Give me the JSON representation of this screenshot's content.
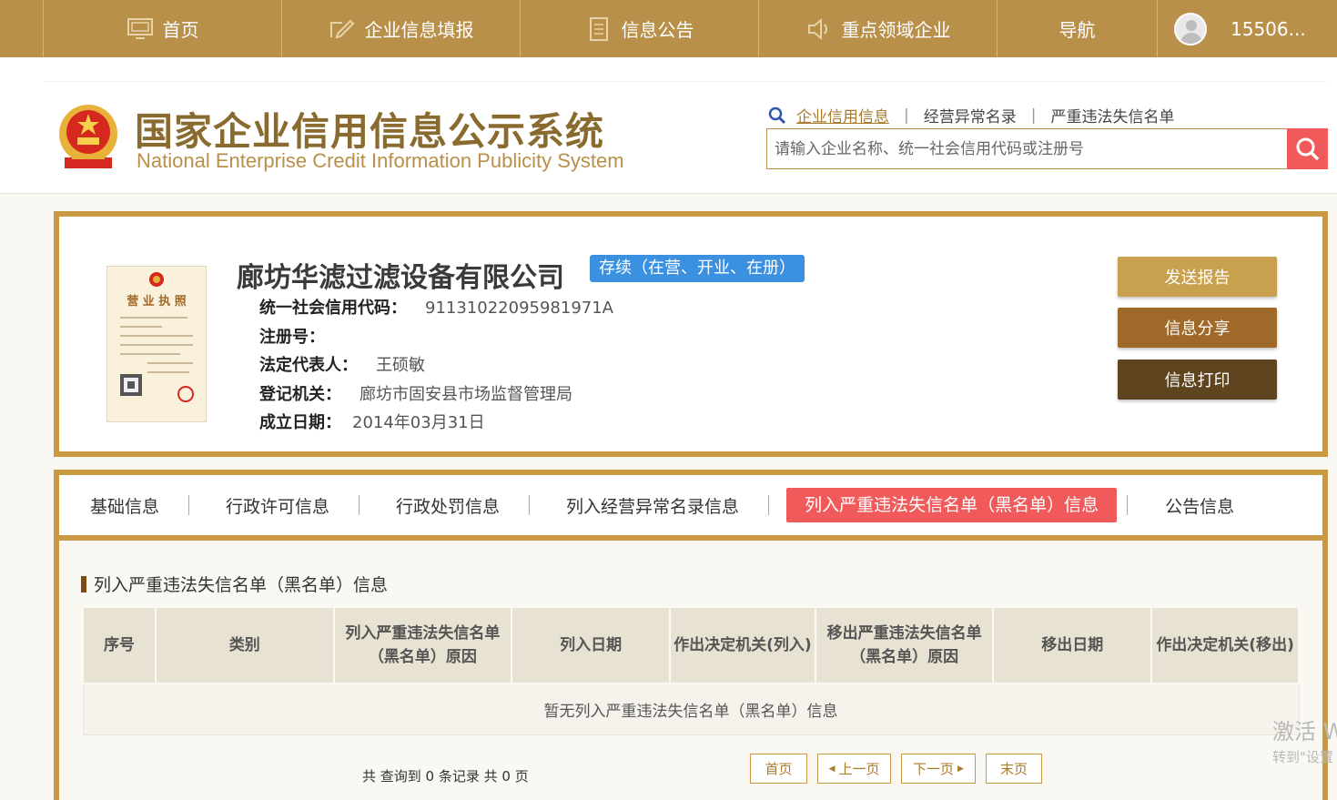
{
  "nav": {
    "home": "首页",
    "report": "企业信息填报",
    "notice": "信息公告",
    "key_sectors": "重点领域企业",
    "guide": "导航",
    "user": "15506..."
  },
  "site": {
    "title_cn": "国家企业信用信息公示系统",
    "title_en": "National Enterprise Credit Information Publicity System"
  },
  "search": {
    "tabs": [
      "企业信用信息",
      "经营异常名录",
      "严重违法失信名单"
    ],
    "placeholder": "请输入企业名称、统一社会信用代码或注册号"
  },
  "company": {
    "name": "廊坊华滤过滤设备有限公司",
    "status": "存续（在营、开业、在册）",
    "fields": [
      {
        "label": "统一社会信用代码：",
        "value": "91131022095981971A"
      },
      {
        "label": "注册号：",
        "value": ""
      },
      {
        "label": "法定代表人：",
        "value": "王硕敏"
      },
      {
        "label": "登记机关：",
        "value": "廊坊市固安县市场监督管理局"
      },
      {
        "label": "成立日期：",
        "value": "2014年03月31日"
      }
    ],
    "license_title": "营 业 执 照"
  },
  "actions": {
    "send": "发送报告",
    "share": "信息分享",
    "print": "信息打印"
  },
  "tabs": [
    {
      "label": "基础信息",
      "active": false
    },
    {
      "label": "行政许可信息",
      "active": false
    },
    {
      "label": "行政处罚信息",
      "active": false
    },
    {
      "label": "列入经营异常名录信息",
      "active": false
    },
    {
      "label": "列入严重违法失信名单（黑名单）信息",
      "active": true
    },
    {
      "label": "公告信息",
      "active": false
    }
  ],
  "section": {
    "title": "列入严重违法失信名单（黑名单）信息"
  },
  "table": {
    "headers": [
      "序号",
      "类别",
      "列入严重违法失信名单（黑名单）原因",
      "列入日期",
      "作出决定机关(列入)",
      "移出严重违法失信名单（黑名单）原因",
      "移出日期",
      "作出决定机关(移出)"
    ],
    "empty": "暂无列入严重违法失信名单（黑名单）信息"
  },
  "pager": {
    "summary": "共 查询到 0 条记录 共 0 页",
    "first": "首页",
    "prev": "上一页",
    "next": "下一页",
    "last": "末页"
  },
  "watermark": {
    "line1": "激活 W",
    "line2": "转到\"设置"
  },
  "colors": {
    "nav_bg": "#b9904a",
    "accent_gold": "#c99a42",
    "active_tab": "#f05a5a",
    "status_badge": "#3b91e0"
  }
}
